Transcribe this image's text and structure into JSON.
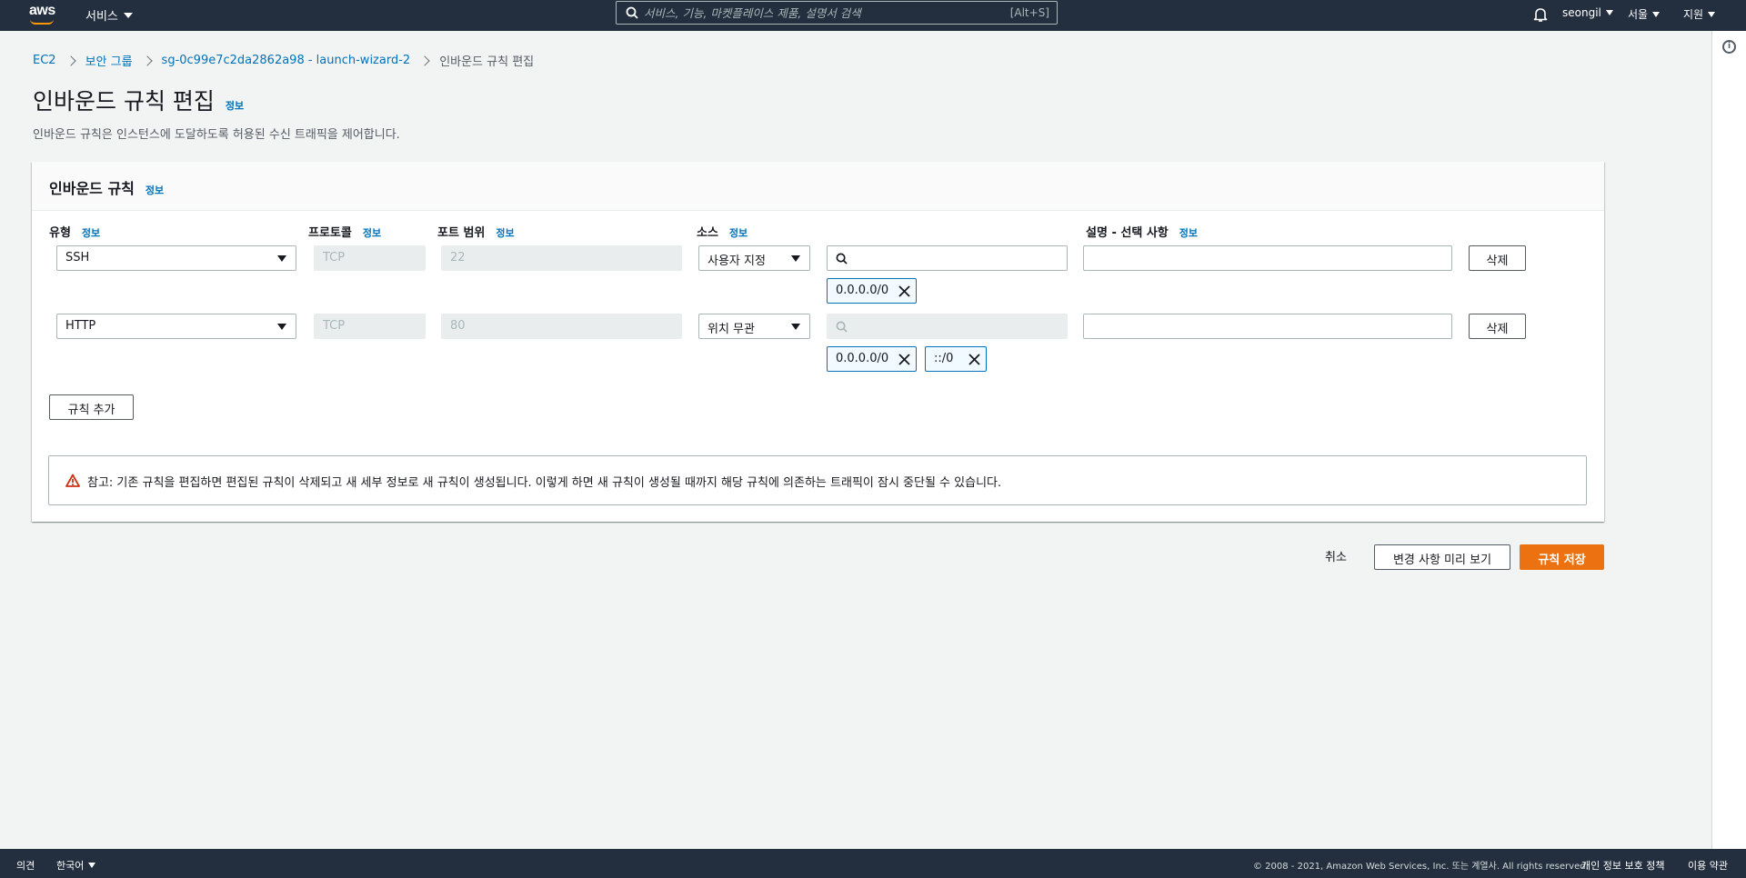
{
  "topnav": {
    "logo_text": "aws",
    "services_label": "서비스",
    "search_placeholder": "서비스, 기능, 마켓플레이스 제품, 설명서 검색",
    "search_shortcut": "[Alt+S]",
    "user_label": "seongil",
    "region_label": "서울",
    "support_label": "지원"
  },
  "breadcrumb": {
    "items": [
      "EC2",
      "보안 그룹",
      "sg-0c99e7c2da2862a98 - launch-wizard-2"
    ],
    "current": "인바운드 규칙 편집"
  },
  "page": {
    "title": "인바운드 규칙 편집",
    "info": "정보",
    "description": "인바운드 규칙은 인스턴스에 도달하도록 허용된 수신 트래픽을 제어합니다."
  },
  "panel": {
    "title": "인바운드 규칙",
    "info": "정보",
    "columns": {
      "type": "유형",
      "protocol": "프로토콜",
      "port_range": "포트 범위",
      "source": "소스",
      "description": "설명 - 선택 사항",
      "info": "정보"
    },
    "rules": [
      {
        "type": "SSH",
        "protocol": "TCP",
        "port": "22",
        "source": "사용자 지정",
        "search_value": "",
        "tokens": [
          "0.0.0.0/0"
        ],
        "description": "",
        "delete_label": "삭제"
      },
      {
        "type": "HTTP",
        "protocol": "TCP",
        "port": "80",
        "source": "위치 무관",
        "search_value": "",
        "tokens": [
          "0.0.0.0/0",
          "::/0"
        ],
        "description": "",
        "delete_label": "삭제"
      }
    ],
    "add_rule_label": "규칙 추가",
    "warning_text": "참고: 기존 규칙을 편집하면 편집된 규칙이 삭제되고 새 세부 정보로 새 규칙이 생성됩니다. 이렇게 하면 새 규칙이 생성될 때까지 해당 규칙에 의존하는 트래픽이 잠시 중단될 수 있습니다."
  },
  "actions": {
    "cancel": "취소",
    "preview": "변경 사항 미리 보기",
    "save": "규칙 저장"
  },
  "footer": {
    "feedback": "의견",
    "language": "한국어",
    "copyright": "© 2008 - 2021, Amazon Web Services, Inc. 또는 계열사. All rights reserved.",
    "privacy": "개인 정보 보호 정책",
    "terms": "이용 약관"
  },
  "colors": {
    "nav_bg": "#232f3e",
    "link": "#0073bb",
    "primary": "#ec7211",
    "warning": "#d13212"
  }
}
